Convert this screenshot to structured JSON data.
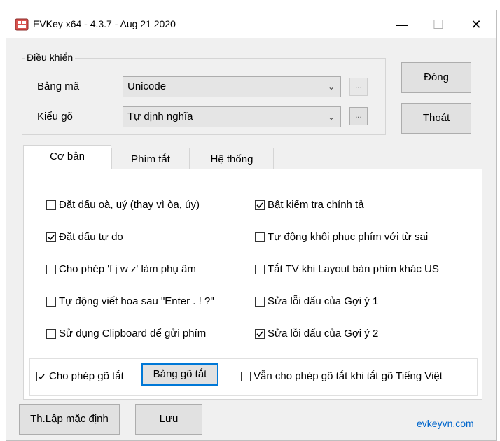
{
  "window": {
    "title": "EVKey x64 - 4.3.7 - Aug 21 2020",
    "min_glyph": "—",
    "max_glyph": "☐",
    "close_glyph": "✕"
  },
  "control_group": {
    "legend": "Điều khiển",
    "charset_label": "Bảng mã",
    "charset_value": "Unicode",
    "typing_label": "Kiểu gõ",
    "typing_value": "Tự định nghĩa",
    "more_glyph": "..."
  },
  "buttons": {
    "close": "Đóng",
    "exit": "Thoát",
    "defaults": "Th.Lập mặc định",
    "save": "Lưu",
    "shortcut_table": "Bảng gõ tắt"
  },
  "tabs": [
    "Cơ bản",
    "Phím tắt",
    "Hệ thống"
  ],
  "left_options": [
    {
      "label": "Đặt dấu oà, uý (thay vì òa, úy)",
      "checked": false
    },
    {
      "label": "Đặt dấu tự do",
      "checked": true
    },
    {
      "label": "Cho phép 'f j w z' làm phụ âm",
      "checked": false
    },
    {
      "label": "Tự động viết hoa sau \"Enter . ! ?\"",
      "checked": false
    },
    {
      "label": "Sử dụng Clipboard để gửi phím",
      "checked": false
    }
  ],
  "right_options": [
    {
      "label": "Bật kiểm tra chính tả",
      "checked": true
    },
    {
      "label": "Tự động khôi phục phím với từ sai",
      "checked": false
    },
    {
      "label": "Tắt TV khi Layout bàn phím khác US",
      "checked": false
    },
    {
      "label": "Sửa lỗi dấu của Gợi ý 1",
      "checked": false
    },
    {
      "label": "Sửa lỗi dấu của Gợi ý 2",
      "checked": true
    }
  ],
  "shortcut": {
    "allow_label": "Cho phép gõ tắt",
    "allow_checked": true,
    "still_allow_label": "Vẫn cho phép gõ tắt khi tắt gõ Tiếng Việt",
    "still_allow_checked": false
  },
  "footer": {
    "link": "evkeyvn.com"
  },
  "colors": {
    "accent": "#0078d7",
    "link": "#0066cc"
  }
}
